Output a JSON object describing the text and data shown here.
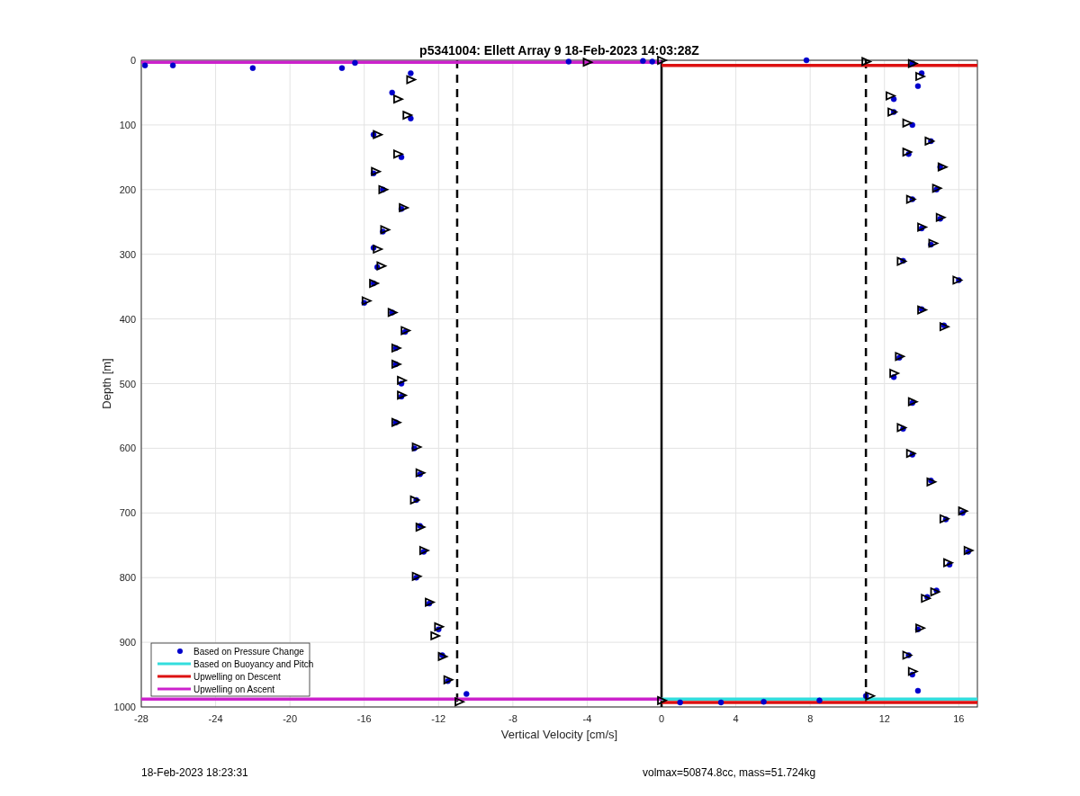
{
  "figure": {
    "chart_data": {
      "type": "scatter",
      "title": "p5341004: Ellett Array 9 18-Feb-2023 14:03:28Z",
      "xlabel": "Vertical Velocity [cm/s]",
      "ylabel": "Depth [m]",
      "xlim": [
        -28,
        17
      ],
      "ylim": [
        1000,
        0
      ],
      "xticks": [
        -28,
        -24,
        -20,
        -16,
        -12,
        -8,
        -4,
        0,
        4,
        8,
        12,
        16
      ],
      "yticks": [
        0,
        100,
        200,
        300,
        400,
        500,
        600,
        700,
        800,
        900,
        1000
      ],
      "grid": true,
      "legend": true,
      "series": [
        {
          "name": "Based on Pressure Change",
          "type": "scatter",
          "marker": "circle",
          "color": "#0000cc",
          "x": [
            -27.8,
            -26.3,
            -22,
            -17.2,
            -16.5,
            -5,
            -1,
            -0.5,
            -13.5,
            -14.5,
            -13.5,
            -15.5,
            -14,
            -15.5,
            -15,
            -14,
            -15,
            -15.5,
            -15.3,
            -15.5,
            -16,
            -14.5,
            -13.8,
            -14.3,
            -14.3,
            -14,
            -14,
            -14.3,
            -13.3,
            -13,
            -13.2,
            -13,
            -12.8,
            -13.2,
            -12.5,
            -12,
            -11.8,
            -11.5,
            -10.5,
            7.8,
            13.5,
            14,
            13.8,
            12.5,
            12.5,
            13.5,
            14.5,
            13.3,
            15,
            14.8,
            13.5,
            15,
            14,
            14.5,
            13,
            16,
            14,
            15.2,
            12.8,
            12.5,
            13.5,
            13,
            13.5,
            14.5,
            16.2,
            15.3,
            16.5,
            15.5,
            14.8,
            14.3,
            13.8,
            13.3,
            13.5,
            13.8,
            1,
            3.2,
            5.5,
            8.5,
            11
          ],
          "values": [
            8,
            8,
            12,
            12,
            4,
            2,
            1,
            2,
            20,
            50,
            90,
            115,
            150,
            175,
            200,
            230,
            265,
            290,
            320,
            345,
            375,
            390,
            420,
            445,
            470,
            500,
            520,
            560,
            600,
            640,
            680,
            720,
            760,
            800,
            840,
            880,
            920,
            960,
            980,
            0,
            5,
            20,
            40,
            60,
            80,
            100,
            125,
            145,
            165,
            200,
            215,
            245,
            260,
            285,
            310,
            340,
            385,
            410,
            460,
            490,
            530,
            570,
            610,
            650,
            700,
            710,
            760,
            780,
            820,
            830,
            880,
            920,
            950,
            975,
            993,
            993,
            992,
            990,
            983
          ]
        },
        {
          "name": "Based on Buoyancy and Pitch",
          "type": "line",
          "color": "#33dddd",
          "x": [
            0,
            17
          ],
          "values": [
            988,
            988
          ]
        },
        {
          "name": "Upwelling on Descent",
          "type": "line",
          "color": "#dd1111",
          "x": [
            0,
            17
          ],
          "values": [
            8,
            8
          ]
        },
        {
          "type": "line",
          "color": "#dd1111",
          "x": [
            0,
            17
          ],
          "values": [
            993,
            993
          ]
        },
        {
          "name": "Upwelling on Ascent",
          "type": "line",
          "color": "#cc22cc",
          "x": [
            -28,
            0
          ],
          "values": [
            3,
            3
          ]
        },
        {
          "type": "line",
          "color": "#cc22cc",
          "x": [
            -28,
            0
          ],
          "values": [
            988,
            988
          ]
        },
        {
          "type": "scatter",
          "marker": "triangle",
          "color": "#000000",
          "x": [
            -4,
            0,
            -13.5,
            -14.2,
            -13.7,
            -15.3,
            -14.2,
            -15.4,
            -15,
            -13.9,
            -14.9,
            -15.3,
            -15.1,
            -15.5,
            -15.9,
            -14.5,
            -13.8,
            -14.3,
            -14.3,
            -14,
            -14,
            -14.3,
            -13.2,
            -13,
            -13.3,
            -13,
            -12.8,
            -13.2,
            -12.5,
            -12,
            -12.2,
            -11.8,
            -11.5,
            -10.9,
            0,
            11,
            13.5,
            13.9,
            12.3,
            12.4,
            13.2,
            14.4,
            13.2,
            15.1,
            14.8,
            13.4,
            15,
            14,
            14.6,
            12.9,
            15.9,
            14,
            15.2,
            12.8,
            12.5,
            13.5,
            12.9,
            13.4,
            14.5,
            16.2,
            15.2,
            16.5,
            15.4,
            14.7,
            14.2,
            13.9,
            13.2,
            13.5,
            11.2
          ],
          "values": [
            3,
            0,
            30,
            60,
            85,
            115,
            145,
            172,
            200,
            228,
            262,
            292,
            318,
            345,
            372,
            390,
            418,
            445,
            470,
            495,
            518,
            560,
            598,
            638,
            680,
            722,
            758,
            798,
            838,
            876,
            890,
            922,
            958,
            992,
            990,
            2,
            5,
            25,
            55,
            80,
            97,
            125,
            142,
            165,
            198,
            215,
            243,
            258,
            283,
            311,
            340,
            386,
            412,
            458,
            484,
            528,
            568,
            608,
            652,
            697,
            709,
            758,
            777,
            822,
            832,
            878,
            920,
            945,
            983
          ]
        }
      ],
      "ref_lines": [
        {
          "axis": "x",
          "value": -11
        },
        {
          "axis": "x",
          "value": 0
        },
        {
          "axis": "x",
          "value": 11
        }
      ]
    }
  },
  "footer": {
    "timestamp": "18-Feb-2023 18:23:31",
    "info": "volmax=50874.8cc, mass=51.724kg"
  }
}
